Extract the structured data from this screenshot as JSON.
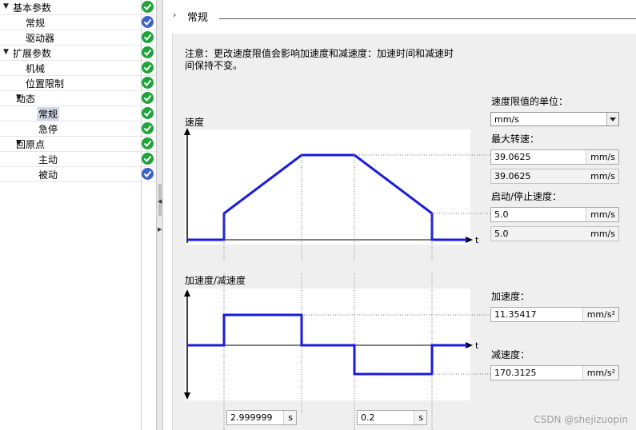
{
  "tree": {
    "items": [
      {
        "label": "基本参数",
        "level": 0,
        "arrow": "▼",
        "status": "green"
      },
      {
        "label": "常规",
        "level": 2,
        "arrow": "",
        "status": "blue"
      },
      {
        "label": "驱动器",
        "level": 2,
        "arrow": "",
        "status": "green"
      },
      {
        "label": "扩展参数",
        "level": 0,
        "arrow": "▼",
        "status": "green"
      },
      {
        "label": "机械",
        "level": 2,
        "arrow": "",
        "status": "green"
      },
      {
        "label": "位置限制",
        "level": 2,
        "arrow": "",
        "status": "green"
      },
      {
        "label": "动态",
        "level": 1,
        "arrow": "▼",
        "status": "green"
      },
      {
        "label": "常规",
        "level": 3,
        "arrow": "",
        "status": "green",
        "selected": true
      },
      {
        "label": "急停",
        "level": 3,
        "arrow": "",
        "status": "green"
      },
      {
        "label": "回原点",
        "level": 1,
        "arrow": "▼",
        "status": "green"
      },
      {
        "label": "主动",
        "level": 3,
        "arrow": "",
        "status": "green"
      },
      {
        "label": "被动",
        "level": 3,
        "arrow": "",
        "status": "blue"
      }
    ]
  },
  "section": {
    "chevron": "›",
    "title": "常规"
  },
  "note": {
    "line1": "注意：更改速度限值会影响加速度和减速度：加速时间和减速时",
    "line2": "间保持不变。"
  },
  "velocity_chart": {
    "label": "速度",
    "t_label": "t",
    "line_color": "#1a1adb"
  },
  "accel_chart": {
    "label": "加速度/减速度",
    "t_label": "t",
    "line_color": "#1a1adb"
  },
  "unit_setting": {
    "label": "速度限值的单位：",
    "value": "mm/s"
  },
  "max_speed": {
    "label": "最大转速：",
    "value": "39.0625",
    "unit": "mm/s",
    "ro_value": "39.0625",
    "ro_unit": "mm/s"
  },
  "start_stop_speed": {
    "label": "启动/停止速度：",
    "value": "5.0",
    "unit": "mm/s",
    "ro_value": "5.0",
    "ro_unit": "mm/s"
  },
  "acceleration": {
    "label": "加速度：",
    "value": "11.35417",
    "unit": "mm/s²"
  },
  "deceleration": {
    "label": "减速度：",
    "value": "170.3125",
    "unit": "mm/s²"
  },
  "accel_time": {
    "value": "2.999999",
    "unit": "s"
  },
  "decel_time": {
    "value": "0.2",
    "unit": "s"
  },
  "watermark": "CSDN @shejizuopin"
}
